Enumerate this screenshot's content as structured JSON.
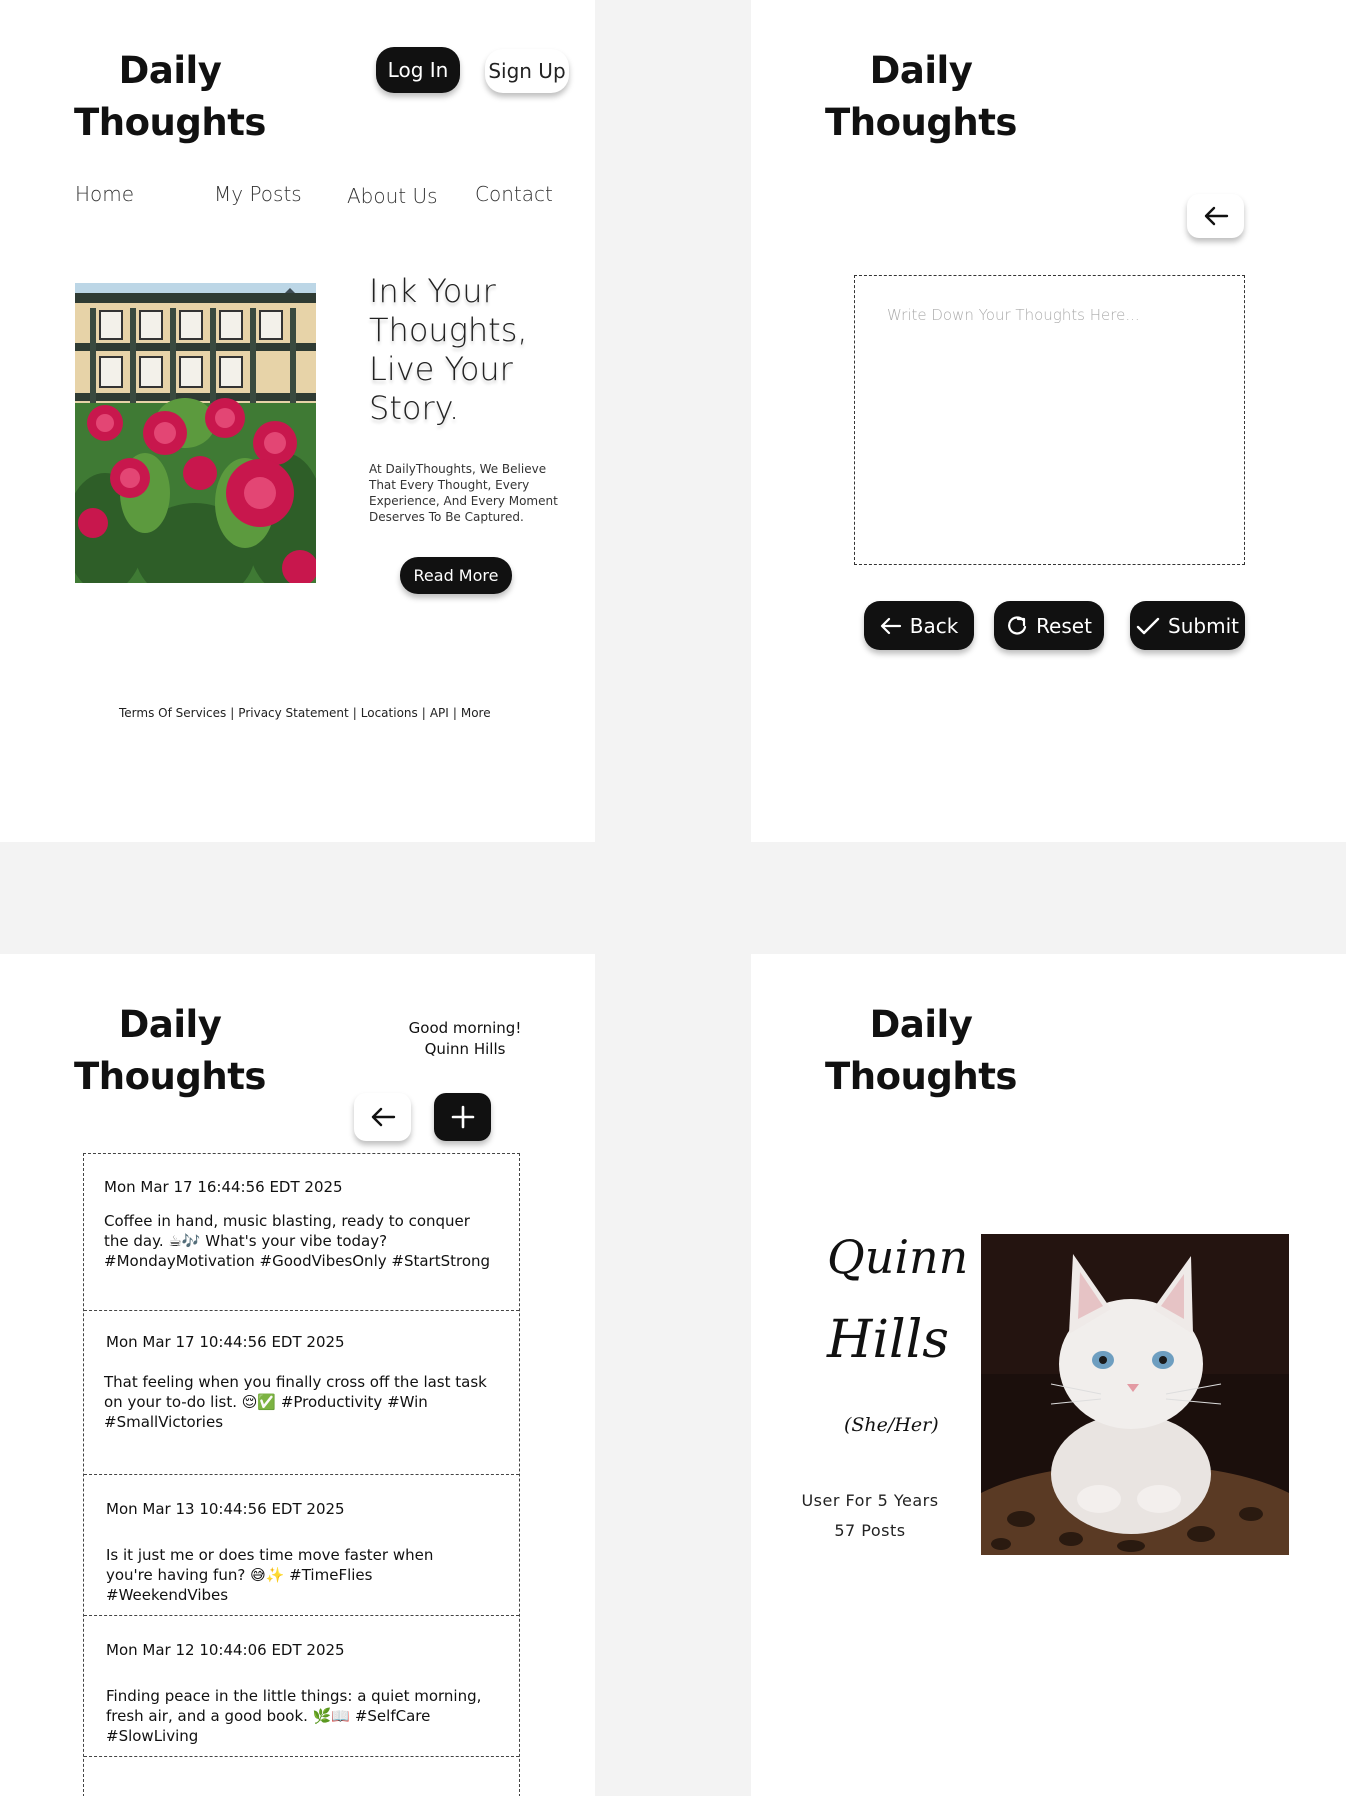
{
  "brand": {
    "line1": "Daily",
    "line2": "Thoughts"
  },
  "landing": {
    "login_label": "Log In",
    "signup_label": "Sign Up",
    "nav": [
      "Home",
      "My Posts",
      "About Us",
      "Contact"
    ],
    "headline": "Ink Your Thoughts, Live Your Story.",
    "blurb": "At DailyThoughts, We Believe That Every Thought, Every Experience, And Every Moment Deserves To Be Captured.",
    "read_more_label": "Read More",
    "footer_links": [
      "Terms Of Services",
      "Privacy Statement",
      "Locations",
      "API",
      "More"
    ]
  },
  "compose": {
    "placeholder": "Write Down Your Thoughts Here...",
    "back_label": "Back",
    "reset_label": "Reset",
    "submit_label": "Submit",
    "icons": {
      "back": "arrow-left-icon",
      "reset": "refresh-icon",
      "submit": "check-icon"
    }
  },
  "feed": {
    "greeting_line1": "Good morning!",
    "greeting_line2": "Quinn Hills",
    "posts": [
      {
        "date": "Mon Mar 17 16:44:56 EDT 2025",
        "text": "Coffee in hand, music blasting, ready to conquer the day. ☕🎶 What's your vibe today? #MondayMotivation #GoodVibesOnly #StartStrong"
      },
      {
        "date": "Mon Mar 17 10:44:56 EDT 2025",
        "text": "That feeling when you finally cross off the last task on your to-do list. 😌✅ #Productivity #Win #SmallVictories"
      },
      {
        "date": "Mon Mar 13 10:44:56 EDT 2025",
        "text": "Is it just me or does time move faster when you're having fun? 😅✨ #TimeFlies #WeekendVibes"
      },
      {
        "date": "Mon Mar 12 10:44:06 EDT 2025",
        "text": "Finding peace in the little things: a quiet morning, fresh air, and a good book. 🌿📖 #SelfCare #SlowLiving"
      }
    ]
  },
  "profile": {
    "first_name": "Quinn",
    "last_name": "Hills",
    "pronouns": "(She/Her)",
    "tenure": "User For 5 Years",
    "post_count": "57 Posts"
  }
}
